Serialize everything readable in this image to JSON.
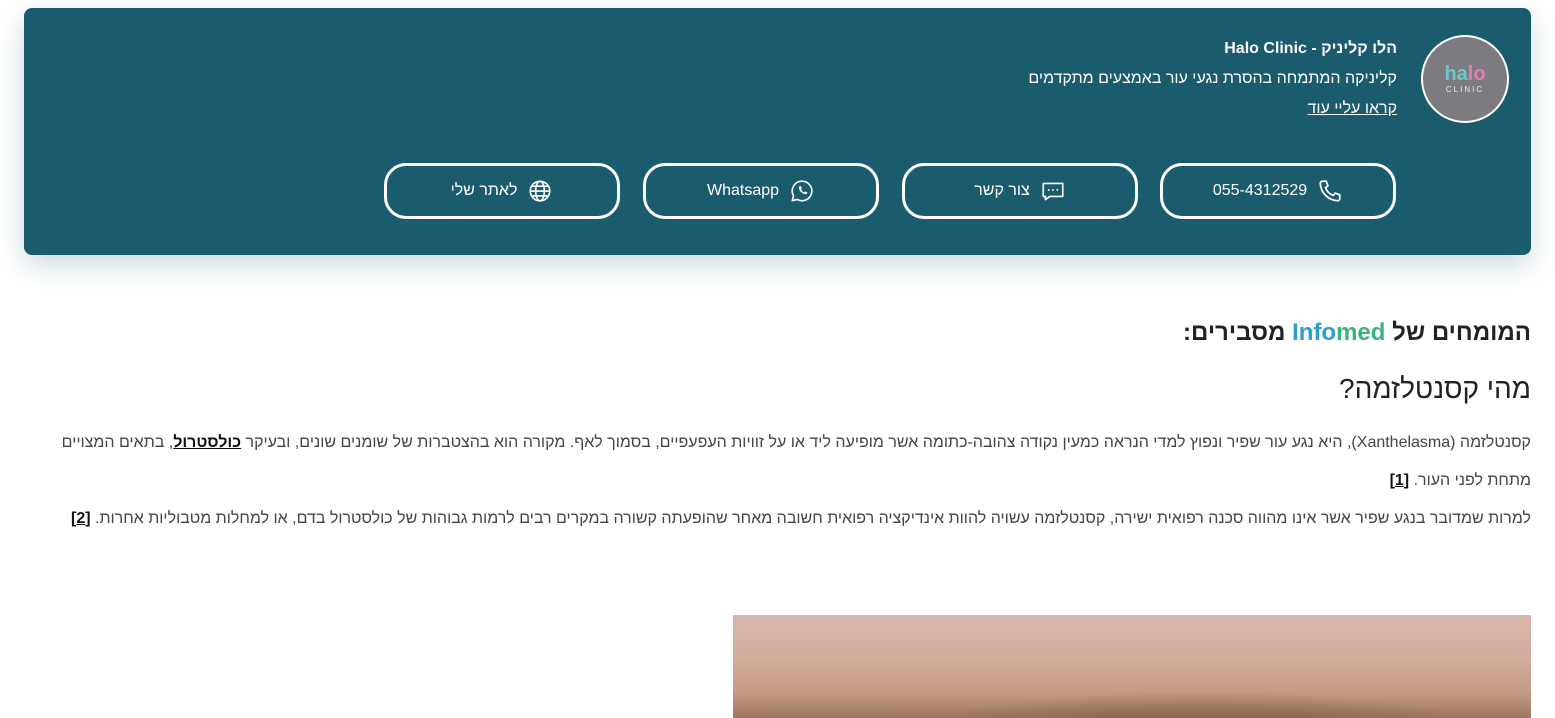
{
  "header": {
    "logo": {
      "word": [
        "ha",
        "lo"
      ],
      "sub": "CLINIC",
      "colors": {
        "teal": "#6cc7c9",
        "pink": "#e37fae",
        "bg": "#7d7b80"
      }
    },
    "title": "הלו קליניק - Halo Clinic",
    "description": "קליניקה המתמחה בהסרת נגעי עור באמצעים מתקדמים",
    "read_more": "קראו עליי עוד",
    "buttons": [
      {
        "label": "055-4312529",
        "icon": "phone-icon"
      },
      {
        "label": "צור קשר",
        "icon": "chat-icon"
      },
      {
        "label": "Whatsapp",
        "icon": "whatsapp-icon"
      },
      {
        "label": "לאתר שלי",
        "icon": "globe-icon"
      }
    ],
    "card_color": "#1b5b6e"
  },
  "article": {
    "experts_prefix": "המומחים של ",
    "brand_part1": "Info",
    "brand_part2": "med",
    "experts_suffix": " מסבירים:",
    "question": "מהי קסנטלזמה?",
    "p1_before": "קסנטלזמה (Xanthelasma), היא נגע עור שפיר ונפוץ למדי הנראה כמעין נקודה צהובה-כתומה אשר מופיעה ליד או על זוויות העפעפיים, בסמוך לאף. מקורה הוא בהצטברות של שומנים שונים, ובעיקר ",
    "p1_link": "כולסטרול",
    "p1_after": ", בתאים המצויים מתחת לפני העור. ",
    "ref1": "[1]",
    "p2": "למרות שמדובר בנגע שפיר אשר אינו מהווה סכנה רפואית ישירה, קסנטלזמה עשויה להוות אינדיקציה רפואית חשובה מאחר שהופעתה קשורה במקרים רבים לרמות גבוהות של כולסטרול בדם, או למחלות מטבוליות אחרות. ",
    "ref2": "[2]"
  }
}
